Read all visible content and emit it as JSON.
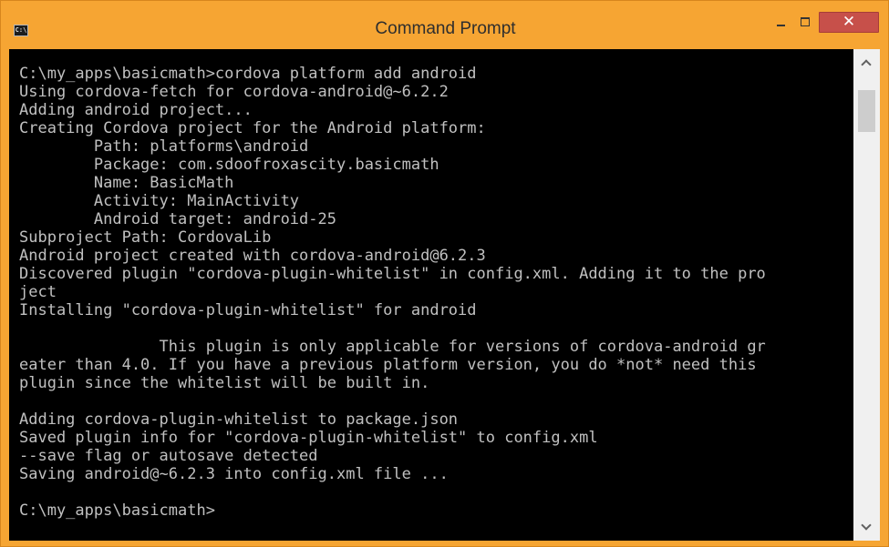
{
  "window": {
    "title": "Command Prompt",
    "icon_text": "C:\\",
    "icon_name": "console-app-icon",
    "colors": {
      "frame": "#f6a533",
      "close_button": "#c7504a",
      "console_background": "#000000",
      "console_text": "#c0c0c0"
    },
    "controls": {
      "minimize_icon": "minimize-icon",
      "maximize_icon": "maximize-icon",
      "close_glyph": "✕"
    }
  },
  "console": {
    "output": "C:\\my_apps\\basicmath>cordova platform add android\nUsing cordova-fetch for cordova-android@~6.2.2\nAdding android project...\nCreating Cordova project for the Android platform:\n        Path: platforms\\android\n        Package: com.sdoofroxascity.basicmath\n        Name: BasicMath\n        Activity: MainActivity\n        Android target: android-25\nSubproject Path: CordovaLib\nAndroid project created with cordova-android@6.2.3\nDiscovered plugin \"cordova-plugin-whitelist\" in config.xml. Adding it to the pro\nject\nInstalling \"cordova-plugin-whitelist\" for android\n\n               This plugin is only applicable for versions of cordova-android gr\neater than 4.0. If you have a previous platform version, you do *not* need this\nplugin since the whitelist will be built in.\n\nAdding cordova-plugin-whitelist to package.json\nSaved plugin info for \"cordova-plugin-whitelist\" to config.xml\n--save flag or autosave detected\nSaving android@~6.2.3 into config.xml file ...\n\nC:\\my_apps\\basicmath>"
  },
  "scrollbar": {
    "up_icon": "chevron-up-icon",
    "down_icon": "chevron-down-icon"
  }
}
